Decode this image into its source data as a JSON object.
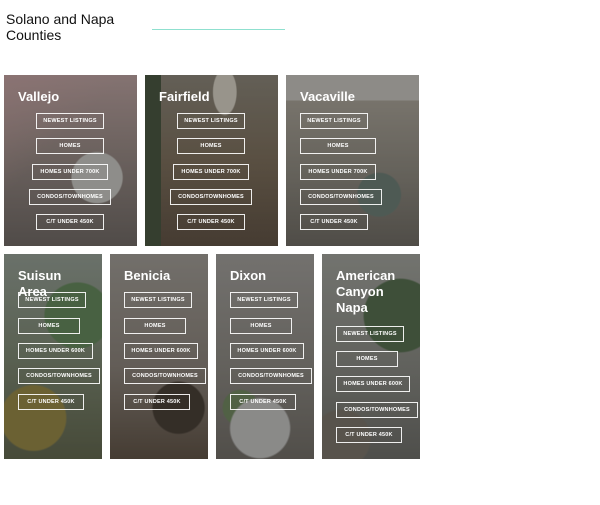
{
  "page": {
    "title": "Solano and Napa Counties",
    "accent_color": "#8fe0cf"
  },
  "cards": [
    {
      "city": "Vallejo",
      "buttons": [
        "NEWEST LISTINGS",
        "HOMES",
        "HOMES UNDER 700K",
        "CONDOS/TOWNHOMES",
        "C/T UNDER 450K"
      ]
    },
    {
      "city": "Fairfield",
      "buttons": [
        "NEWEST LISTINGS",
        "HOMES",
        "HOMES UNDER 700K",
        "CONDOS/TOWNHOMES",
        "C/T UNDER 450K"
      ]
    },
    {
      "city": "Vacaville",
      "buttons": [
        "NEWEST LISTINGS",
        "HOMES",
        "HOMES UNDER 700K",
        "CONDOS/TOWNHOMES",
        "C/T UNDER 450K"
      ]
    },
    {
      "city": "Suisun\nArea",
      "buttons": [
        "NEWEST LISTINGS",
        "HOMES",
        "HOMES UNDER 600K",
        "CONDOS/TOWNHOMES",
        "C/T UNDER 450K"
      ]
    },
    {
      "city": "Benicia",
      "buttons": [
        "NEWEST LISTINGS",
        "HOMES",
        "HOMES UNDER 600K",
        "CONDOS/TOWNHOMES",
        "C/T UNDER 450K"
      ]
    },
    {
      "city": "Dixon",
      "buttons": [
        "NEWEST LISTINGS",
        "HOMES",
        "HOMES UNDER 600K",
        "CONDOS/TOWNHOMES",
        "C/T UNDER 450K"
      ]
    },
    {
      "city": "American\nCanyon\nNapa",
      "buttons": [
        "NEWEST LISTINGS",
        "HOMES",
        "HOMES UNDER 600K",
        "CONDOS/TOWNHOMES",
        "C/T UNDER 450K"
      ]
    }
  ]
}
